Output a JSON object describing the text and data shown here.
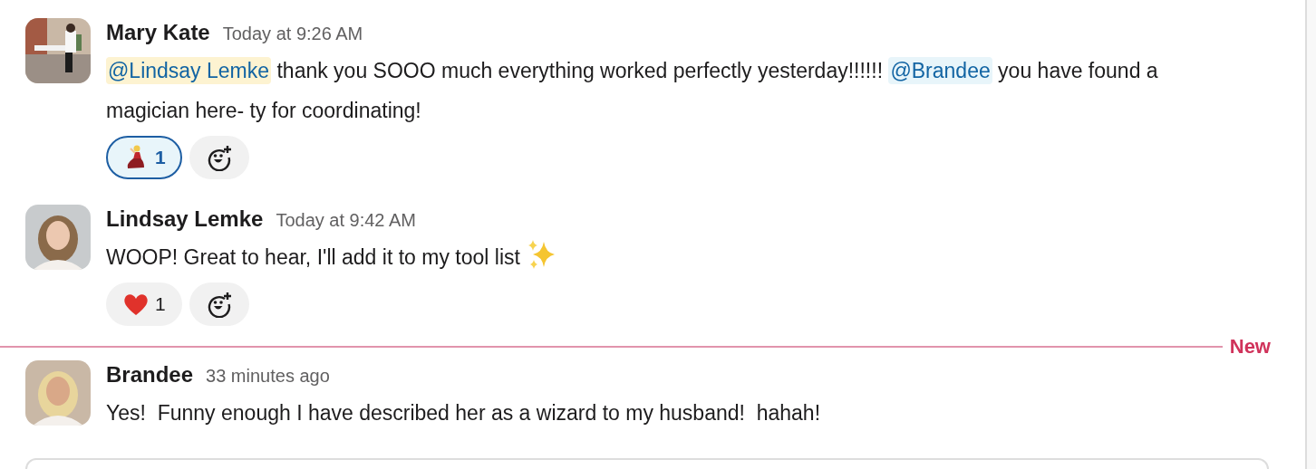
{
  "messages": [
    {
      "author": "Mary Kate",
      "time": "Today at 9:26 AM",
      "avatar": {
        "kind": "picture"
      },
      "parts": [
        {
          "kind": "mention",
          "text": "@Lindsay Lemke",
          "highlighted": true
        },
        {
          "kind": "text",
          "text": " thank you SOOO much everything worked perfectly yesterday!!!!!! "
        },
        {
          "kind": "mention",
          "text": "@Brandee",
          "highlighted": false
        },
        {
          "kind": "text",
          "text": " you have found a magician here- ty for coordinating!"
        }
      ],
      "reactions": [
        {
          "kind": "dancer",
          "count": "1",
          "selected": true
        }
      ]
    },
    {
      "author": "Lindsay Lemke",
      "time": "Today at 9:42 AM",
      "avatar": {
        "kind": "picture"
      },
      "parts": [
        {
          "kind": "text",
          "text": "WOOP! Great to hear, I'll add it to my tool list "
        },
        {
          "kind": "sparkles"
        }
      ],
      "reactions": [
        {
          "kind": "heart",
          "count": "1",
          "selected": false
        }
      ]
    },
    {
      "divider": "New"
    },
    {
      "author": "Brandee",
      "time": "33 minutes ago",
      "avatar": {
        "kind": "picture"
      },
      "parts": [
        {
          "kind": "text",
          "text": "Yes!  Funny enough I have described her as a wizard to my husband!  hahah!"
        }
      ]
    }
  ],
  "composer": {
    "kind": "field"
  }
}
